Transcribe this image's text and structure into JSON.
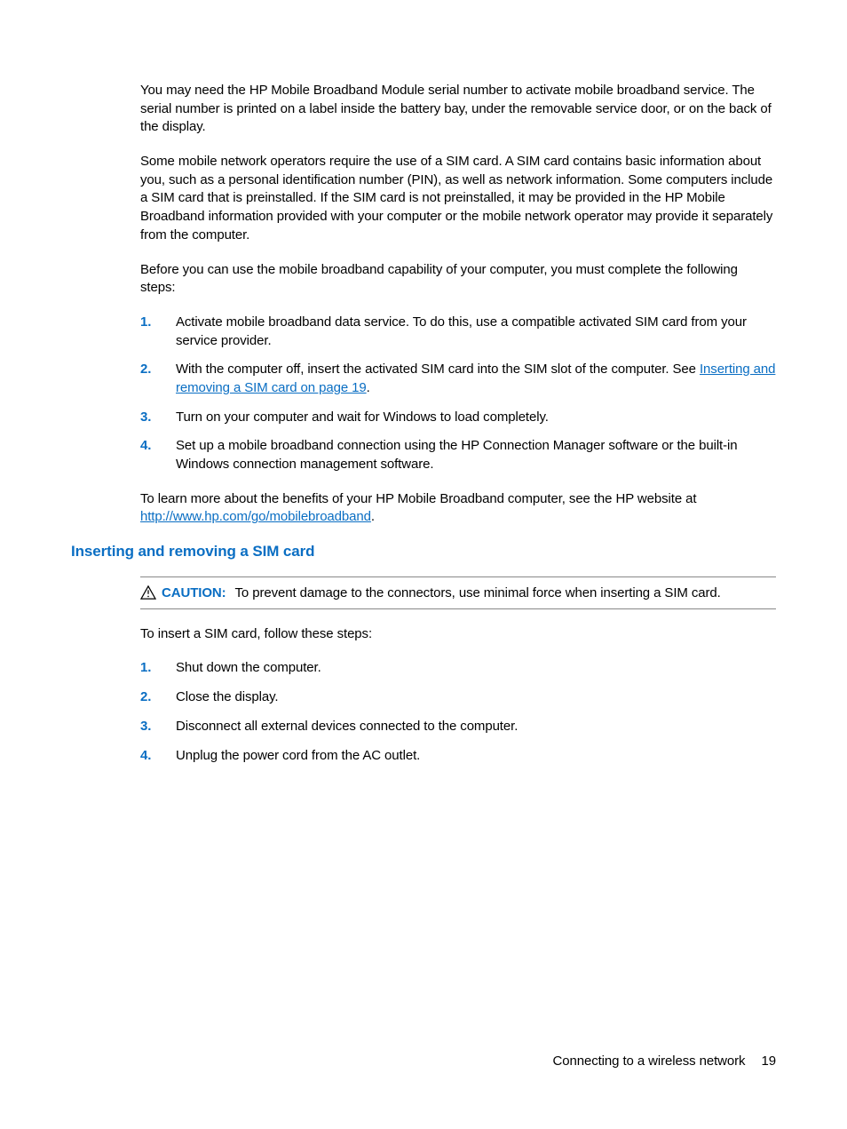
{
  "para1": "You may need the HP Mobile Broadband Module serial number to activate mobile broadband service. The serial number is printed on a label inside the battery bay, under the removable service door, or on the back of the display.",
  "para2": "Some mobile network operators require the use of a SIM card. A SIM card contains basic information about you, such as a personal identification number (PIN), as well as network information. Some computers include a SIM card that is preinstalled. If the SIM card is not preinstalled, it may be provided in the HP Mobile Broadband information provided with your computer or the mobile network operator may provide it separately from the computer.",
  "para3": "Before you can use the mobile broadband capability of your computer, you must complete the following steps:",
  "list1": {
    "n1": "1.",
    "t1": "Activate mobile broadband data service. To do this, use a compatible activated SIM card from your service provider.",
    "n2": "2.",
    "t2a": "With the computer off, insert the activated SIM card into the SIM slot of the computer. See ",
    "t2link": "Inserting and removing a SIM card on page 19",
    "t2b": ".",
    "n3": "3.",
    "t3": "Turn on your computer and wait for Windows to load completely.",
    "n4": "4.",
    "t4": "Set up a mobile broadband connection using the HP Connection Manager software or the built-in Windows connection management software."
  },
  "para4a": "To learn more about the benefits of your HP Mobile Broadband computer, see the HP website at ",
  "para4link": "http://www.hp.com/go/mobilebroadband",
  "para4b": ".",
  "heading": "Inserting and removing a SIM card",
  "caution": {
    "label": "CAUTION:",
    "text": "To prevent damage to the connectors, use minimal force when inserting a SIM card."
  },
  "para5": "To insert a SIM card, follow these steps:",
  "list2": {
    "n1": "1.",
    "t1": "Shut down the computer.",
    "n2": "2.",
    "t2": "Close the display.",
    "n3": "3.",
    "t3": "Disconnect all external devices connected to the computer.",
    "n4": "4.",
    "t4": "Unplug the power cord from the AC outlet."
  },
  "footer": {
    "section": "Connecting to a wireless network",
    "page": "19"
  }
}
